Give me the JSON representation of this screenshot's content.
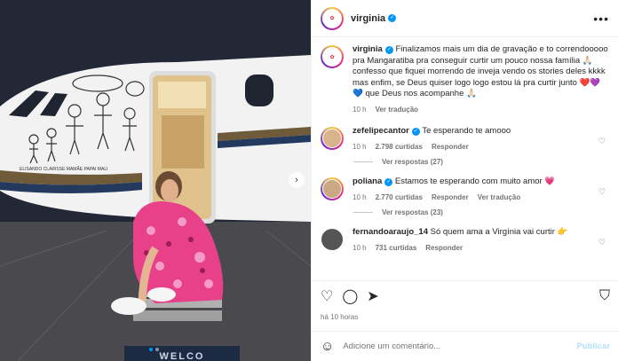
{
  "post": {
    "username": "virginia",
    "caption": "Finalizamos mais um dia de gravação e to correndooooo pra Mangaratiba pra conseguir curtir um pouco nossa família 🙏🏻 confesso que fiquei morrendo de inveja vendo os stories deles kkkk mas enfim, se Deus quiser logo logo estou lá pra curtir junto ❤️💜💙 que Deus nos acompanhe 🙏🏻",
    "caption_time": "10 h",
    "translate": "Ver tradução",
    "posted_ago": "há 10 horas",
    "photo_overlay": "WELCO",
    "drawing_names": "ELISANDO CLARISSE MAMÃE PAPAI MALI"
  },
  "comments": [
    {
      "user": "zefelipecantor",
      "verified": true,
      "text": "Te esperando te amooo",
      "time": "10 h",
      "likes": "2.798 curtidas",
      "reply": "Responder",
      "translate": "",
      "view_replies": "Ver respostas (27)"
    },
    {
      "user": "poliana",
      "verified": true,
      "text": "Estamos te esperando com muito amor 💗",
      "time": "10 h",
      "likes": "2.770 curtidas",
      "reply": "Responder",
      "translate": "Ver tradução",
      "view_replies": "Ver respostas (23)"
    },
    {
      "user": "fernandoaraujo_14",
      "verified": false,
      "text": "Só quem ama a Virgínia vai curtir 👉",
      "time": "10 h",
      "likes": "731 curtidas",
      "reply": "Responder",
      "translate": "",
      "view_replies": ""
    }
  ],
  "add_comment": {
    "placeholder": "Adicione um comentário...",
    "publish": "Publicar"
  },
  "icons": [
    "heart-icon",
    "comment-icon",
    "share-icon",
    "save-icon",
    "emoji-icon",
    "more-icon",
    "verified-icon"
  ],
  "colors": {
    "accent": "#0095f6",
    "outfit": "#e8418a",
    "panel_border": "#efefef"
  }
}
